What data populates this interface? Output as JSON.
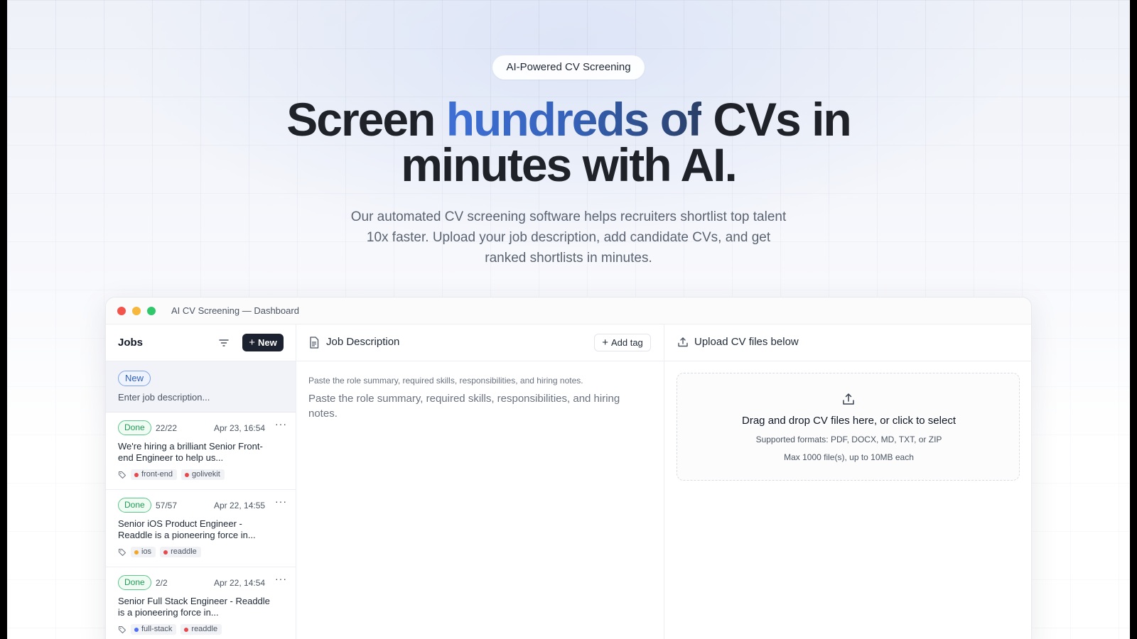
{
  "hero": {
    "pill": "AI-Powered CV Screening",
    "title_a": "Screen ",
    "title_highlight": "hundreds of",
    "title_b": " CVs in",
    "title_line2": "minutes with AI.",
    "subtitle": "Our automated CV screening software helps recruiters shortlist top talent 10x faster. Upload your job description, add candidate CVs, and get ranked shortlists in minutes."
  },
  "window": {
    "title": "AI CV Screening — Dashboard"
  },
  "jobs": {
    "header": "Jobs",
    "new_button": "New",
    "new_item": {
      "badge": "New",
      "placeholder": "Enter job description..."
    },
    "items": [
      {
        "status": "Done",
        "count": "22/22",
        "date": "Apr 23, 16:54",
        "title": "We're hiring a brilliant Senior Front-end Engineer to help us...",
        "tags": [
          {
            "label": "front-end",
            "color": "#e5484d"
          },
          {
            "label": "golivekit",
            "color": "#e5484d"
          }
        ]
      },
      {
        "status": "Done",
        "count": "57/57",
        "date": "Apr 22, 14:55",
        "title": "Senior iOS Product Engineer - Readdle is a pioneering force in...",
        "tags": [
          {
            "label": "ios",
            "color": "#f5a524"
          },
          {
            "label": "readdle",
            "color": "#e5484d"
          }
        ]
      },
      {
        "status": "Done",
        "count": "2/2",
        "date": "Apr 22, 14:54",
        "title": "Senior Full Stack Engineer - Readdle is a pioneering force in...",
        "tags": [
          {
            "label": "full-stack",
            "color": "#4f6ef7"
          },
          {
            "label": "readdle",
            "color": "#e5484d"
          }
        ]
      }
    ]
  },
  "description": {
    "header": "Job Description",
    "add_tag": "Add tag",
    "hint": "Paste the role summary, required skills, responsibilities, and hiring notes.",
    "placeholder": "Paste the role summary, required skills, responsibilities, and hiring notes."
  },
  "upload": {
    "header": "Upload CV files below",
    "dropzone_title": "Drag and drop CV files here, or click to select",
    "formats": "Supported formats: PDF, DOCX, MD, TXT, or ZIP",
    "max": "Max 1000 file(s), up to 10MB each"
  },
  "colors": {
    "accent": "#3562b8",
    "done": "#1f9d55",
    "new_button_bg": "#1c2230"
  }
}
